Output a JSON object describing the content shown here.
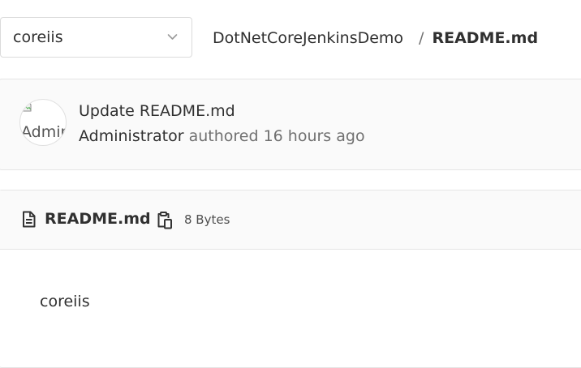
{
  "branch_selector": {
    "value": "coreiis",
    "icon": "chevron-down-icon"
  },
  "breadcrumb": {
    "project": "DotNetCoreJenkinsDemo",
    "separator": "/",
    "file": "README.md"
  },
  "last_commit": {
    "avatar_alt": "Admin",
    "title": "Update README.md",
    "author": "Administrator",
    "authored_text": "authored 16 hours ago"
  },
  "file": {
    "icon": "file-text-icon",
    "name": "README.md",
    "copy_icon": "copy-to-clipboard-icon",
    "size": "8 Bytes",
    "content": "coreiis"
  },
  "colors": {
    "text": "#303030",
    "muted": "#707070",
    "border": "#e5e5e5",
    "panel_background": "#fafafa"
  }
}
